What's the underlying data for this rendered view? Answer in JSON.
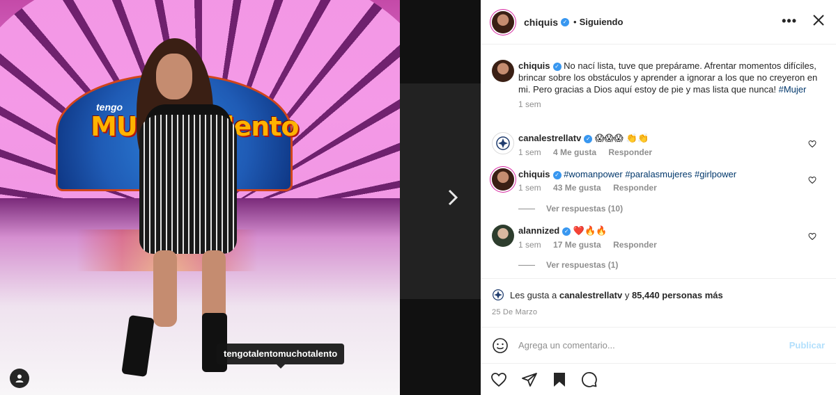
{
  "post": {
    "tag_label": "tengotalentomuchotalento",
    "stage_logo_small": "tengo",
    "stage_logo_big": "MUcho talento"
  },
  "header": {
    "username": "chiquis",
    "separator": "•",
    "follow_status": "Siguiendo",
    "more": "•••"
  },
  "caption": {
    "username": "chiquis",
    "text": "No nací lista, tuve que prepárame. Afrentar momentos difíciles, brincar sobre los obstáculos y aprender a ignorar a los que no creyeron en mi. Pero gracias a Dios aquí estoy de pie y mas lista que nunca!",
    "hashtag": "#Mujer",
    "time": "1 sem"
  },
  "comments": [
    {
      "username": "canalestrellatv",
      "text": "😱😱😱 👏👏",
      "time": "1 sem",
      "likes": "4 Me gusta",
      "reply": "Responder"
    },
    {
      "username": "chiquis",
      "hashtags": [
        "#womanpower",
        "#paralasmujeres",
        "#girlpower"
      ],
      "time": "1 sem",
      "likes": "43 Me gusta",
      "reply": "Responder",
      "view_replies": "Ver respuestas (10)"
    },
    {
      "username": "alannized",
      "text": "❤️🔥🔥",
      "time": "1 sem",
      "likes": "17 Me gusta",
      "reply": "Responder",
      "view_replies": "Ver respuestas (1)"
    }
  ],
  "likes": {
    "prefix": "Les gusta a",
    "user": "canalestrellatv",
    "connector": "y",
    "count": "85,440 personas más"
  },
  "date": "25 De Marzo",
  "add_comment": {
    "placeholder": "Agrega un comentario...",
    "publish": "Publicar"
  },
  "colors": {
    "verified": "#3897f0",
    "hashtag": "#00376b",
    "publish_disabled": "#b2dffc",
    "muted": "#8e8e8e"
  }
}
